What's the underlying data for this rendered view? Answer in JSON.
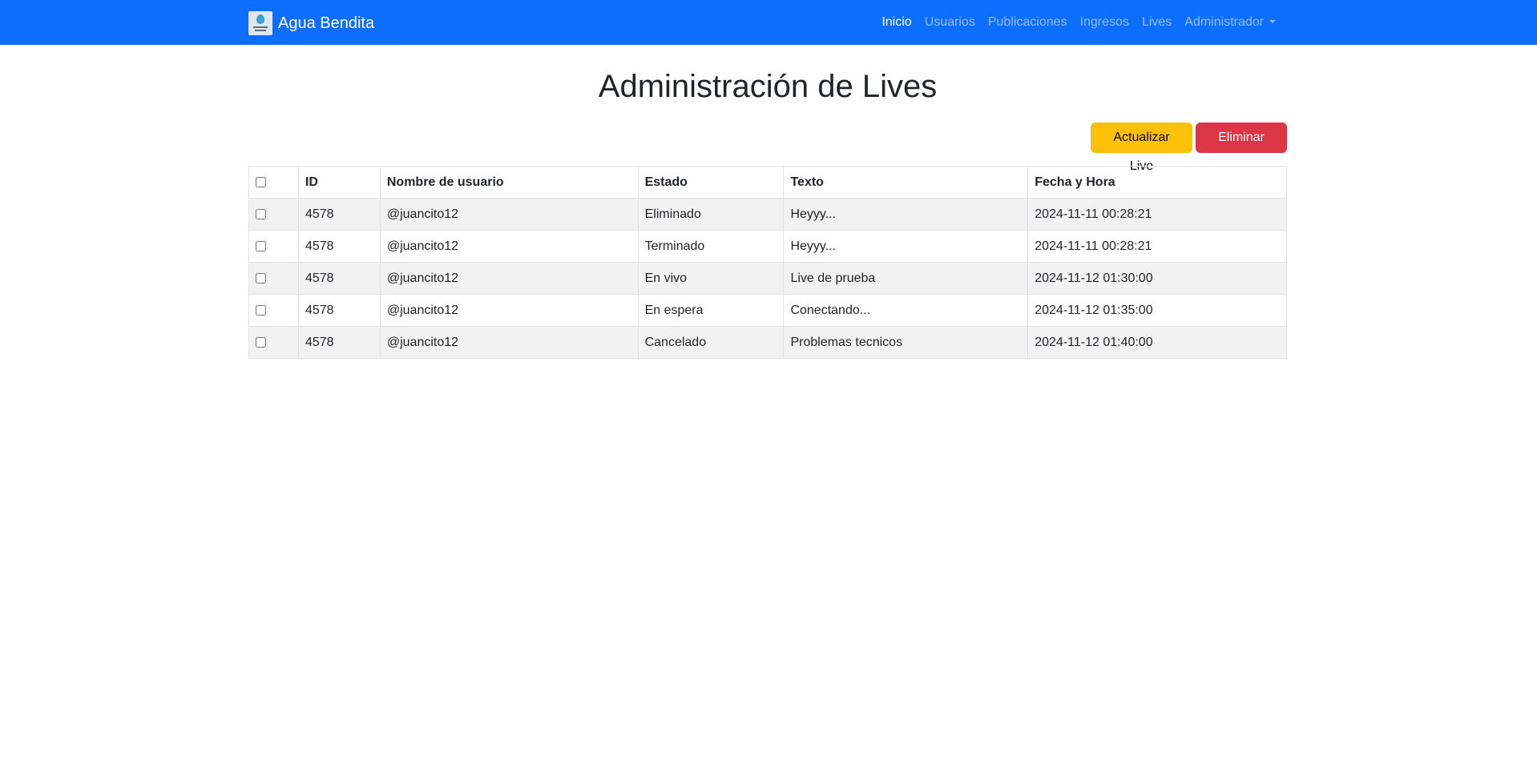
{
  "navbar": {
    "brand": "Agua Bendita",
    "links": [
      "Inicio",
      "Usuarios",
      "Publicaciones",
      "Ingresos",
      "Lives"
    ],
    "dropdown": "Administrador",
    "colors": {
      "background": "#0d6efd",
      "active": "#ffffff"
    }
  },
  "page": {
    "title": "Administración de Lives"
  },
  "actions": {
    "update_label": "Actualizar Live",
    "delete_label": "Eliminar Live"
  },
  "table": {
    "headers": [
      "ID",
      "Nombre de usuario",
      "Estado",
      "Texto",
      "Fecha y Hora"
    ],
    "rows": [
      [
        "4578",
        "@juancito12",
        "Eliminado",
        "Heyyy...",
        "2024-11-11 00:28:21"
      ],
      [
        "4578",
        "@juancito12",
        "Terminado",
        "Heyyy...",
        "2024-11-11 00:28:21"
      ],
      [
        "4578",
        "@juancito12",
        "En vivo",
        "Live de prueba",
        "2024-11-12 01:30:00"
      ],
      [
        "4578",
        "@juancito12",
        "En espera",
        "Conectando...",
        "2024-11-12 01:35:00"
      ],
      [
        "4578",
        "@juancito12",
        "Cancelado",
        "Problemas tecnicos",
        "2024-11-12 01:40:00"
      ]
    ]
  }
}
